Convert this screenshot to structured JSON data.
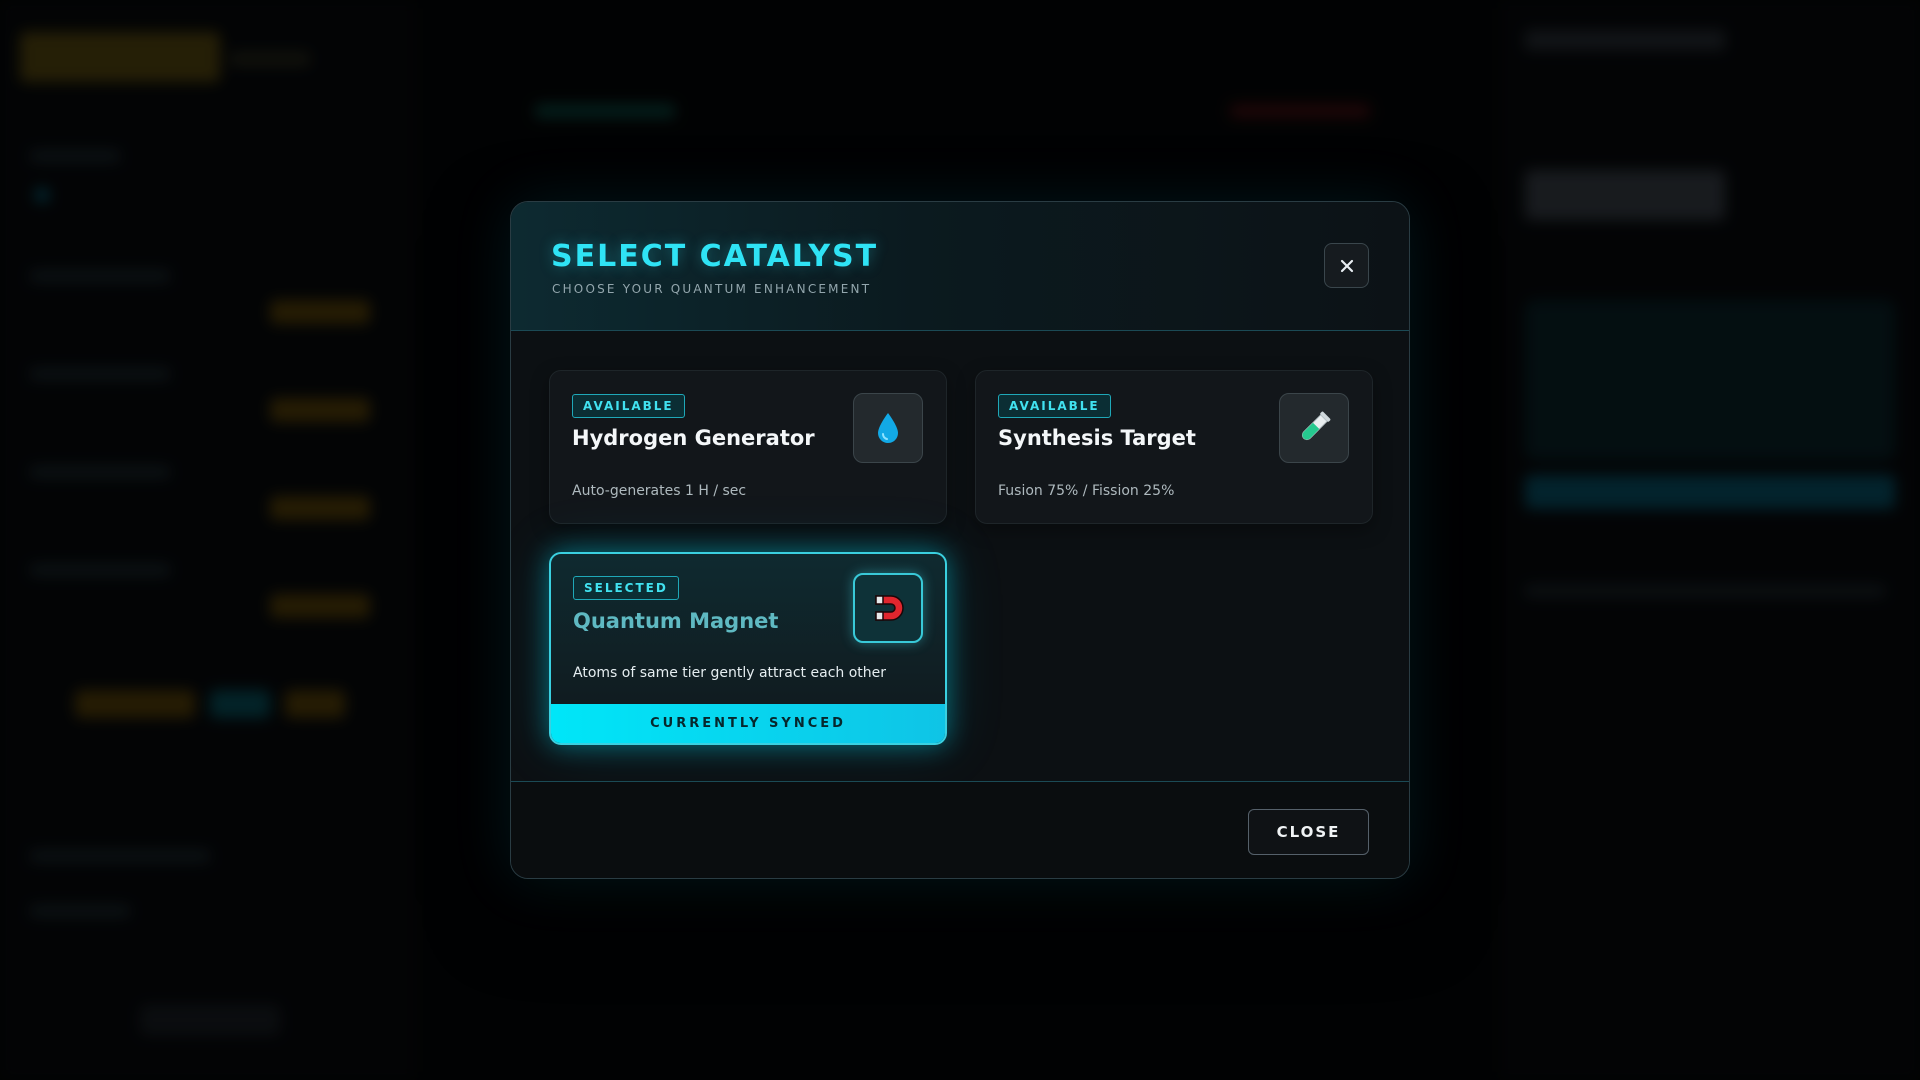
{
  "modal": {
    "title": "SELECT CATALYST",
    "subtitle": "CHOOSE YOUR QUANTUM ENHANCEMENT",
    "close_label": "CLOSE"
  },
  "catalysts": [
    {
      "status": "AVAILABLE",
      "name": "Hydrogen Generator",
      "description": "Auto-generates 1 H / sec",
      "icon": "water-drop-icon",
      "selected": false
    },
    {
      "status": "AVAILABLE",
      "name": "Synthesis Target",
      "description": "Fusion 75% / Fission 25%",
      "icon": "test-tube-icon",
      "selected": false
    },
    {
      "status": "SELECTED",
      "name": "Quantum Magnet",
      "description": "Atoms of same tier gently attract each other",
      "icon": "magnet-icon",
      "selected": true,
      "synced_label": "CURRENTLY SYNCED"
    }
  ],
  "colors": {
    "accent": "#2fe3f5",
    "synced_bar": "#00e6f8",
    "background": "#020304",
    "modal_bg": "#0c1013"
  }
}
